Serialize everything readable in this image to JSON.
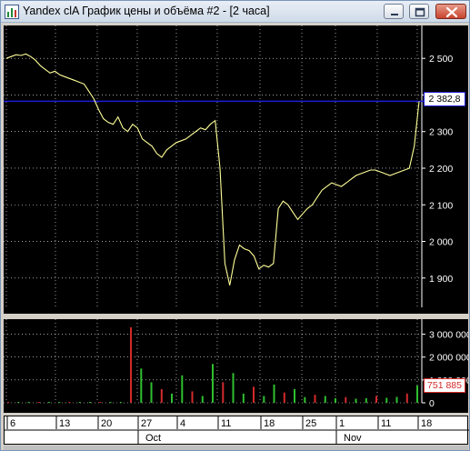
{
  "window": {
    "title": "Yandex clA График цены и объёма #2 - [2 часа]",
    "icon": "chart-app-icon",
    "controls": [
      "minimize-icon",
      "maximize-icon",
      "close-icon"
    ]
  },
  "colors": {
    "background": "#000000",
    "price_line": "#ffff99",
    "grid": "#ffffff",
    "level_line": "#1b1bd6",
    "volume_up": "#2fbf2f",
    "volume_down": "#d42a2a"
  },
  "price_pane": {
    "y_ticks": [
      "2 500",
      "2 400",
      "2 300",
      "2 200",
      "2 100",
      "2 000",
      "1 900"
    ],
    "current_price": "2 382,8",
    "level_value": 2382.8
  },
  "volume_pane": {
    "y_ticks": [
      "3 000 000",
      "2 000 000",
      "1 000 000",
      "0"
    ],
    "current_volume": "751 885"
  },
  "time_axis": {
    "day_labels": [
      "6",
      "13",
      "20",
      "27",
      "4",
      "11",
      "18",
      "25",
      "1",
      "11",
      "18"
    ],
    "month_labels": [
      "Oct",
      "Nov"
    ]
  },
  "chart_data": {
    "type": "line",
    "title": "",
    "xlabel": "",
    "ylabel": "",
    "ylim": [
      1820,
      2570
    ],
    "series": [
      {
        "values": [
          2500,
          2505,
          2510,
          2508,
          2512,
          2505,
          2495,
          2480,
          2470,
          2460,
          2465,
          2455,
          2450,
          2445,
          2440,
          2435,
          2430,
          2410,
          2390,
          2360,
          2335,
          2325,
          2320,
          2340,
          2310,
          2300,
          2320,
          2310,
          2280,
          2270,
          2260,
          2240,
          2230,
          2250,
          2260,
          2270,
          2275,
          2280,
          2290,
          2300,
          2310,
          2305,
          2320,
          2330,
          2200,
          1940,
          1880,
          1950,
          1990,
          1980,
          1975,
          1960,
          1925,
          1935,
          1930,
          1940,
          2090,
          2110,
          2100,
          2080,
          2060,
          2075,
          2090,
          2100,
          2120,
          2140,
          2150,
          2160,
          2155,
          2150,
          2160,
          2170,
          2180,
          2185,
          2190,
          2195,
          2195,
          2190,
          2185,
          2180,
          2185,
          2190,
          2195,
          2200,
          2260,
          2382.8
        ]
      },
      {
        "values": [
          1000,
          1500,
          900,
          1200,
          800,
          1400,
          2000,
          1700,
          1100,
          900,
          1300,
          2200,
          3300000,
          1500000,
          900000,
          600000,
          400000,
          1200000,
          500000,
          300000,
          1700000,
          900000,
          1300000,
          400000,
          700000,
          300000,
          800000,
          450000,
          600000,
          250000,
          350000,
          300000,
          200000,
          250000,
          180000,
          200000,
          300000,
          220000,
          260000,
          400000,
          751885
        ]
      }
    ]
  }
}
